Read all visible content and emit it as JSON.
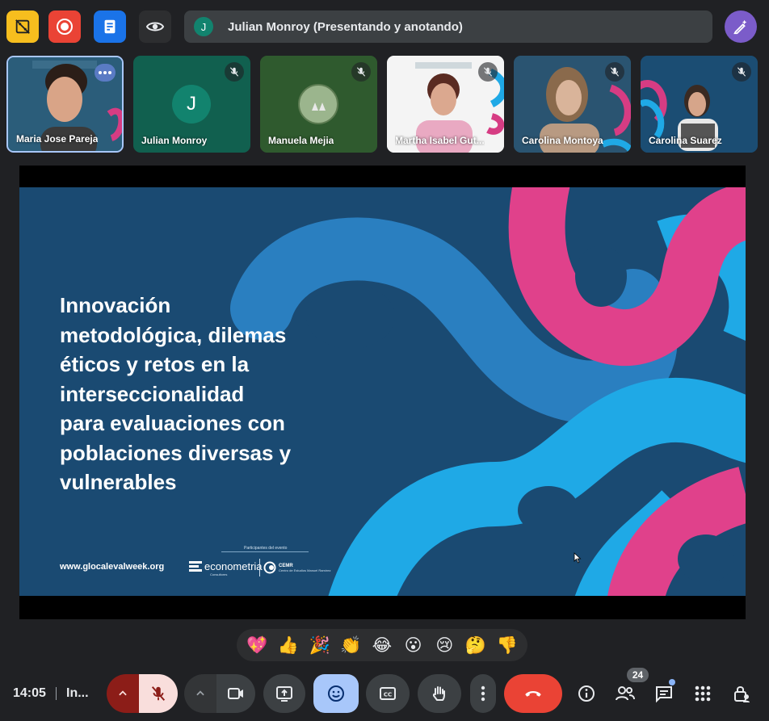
{
  "topbar": {
    "presenter_initial": "J",
    "presenter_text": "Julian Monroy (Presentando y anotando)"
  },
  "participants": [
    {
      "name": "Maria Jose Pareja"
    },
    {
      "name": "Julian Monroy",
      "initial": "J"
    },
    {
      "name": "Manuela Mejia"
    },
    {
      "name": "Martha Isabel Gut..."
    },
    {
      "name": "Carolina Montoya"
    },
    {
      "name": "Carolina Suarez"
    }
  ],
  "slide": {
    "title_lines": [
      "Innovación",
      "metodológica, dilemas",
      "éticos y retos en la",
      "interseccionalidad",
      "para evaluaciones con",
      "poblaciones diversas y",
      "vulnerables"
    ],
    "url": "www.glocalevalweek.org",
    "partners_label": "Participantes del evento",
    "logo_econometria": "econometria",
    "logo_econometria_sub": "Consultores",
    "logo_cemr": "CEMR",
    "logo_cemr_sub": "Centro de Estudios Manuel Ramírez"
  },
  "reactions": [
    "💖",
    "👍",
    "🎉",
    "👏",
    "😂",
    "😮",
    "😢",
    "🤔",
    "👎"
  ],
  "bottombar": {
    "time": "14:05",
    "meeting": "In...",
    "participant_count": "24"
  },
  "colors": {
    "background": "#202124",
    "slide_bg": "#1a4a72",
    "end_call": "#ea4335",
    "mic_off_bg": "#f9dedc",
    "reaction_active": "#a8c7fa",
    "pink": "#e0418b",
    "blue_light": "#1fa9e6",
    "blue_mid": "#2a7fc0"
  }
}
